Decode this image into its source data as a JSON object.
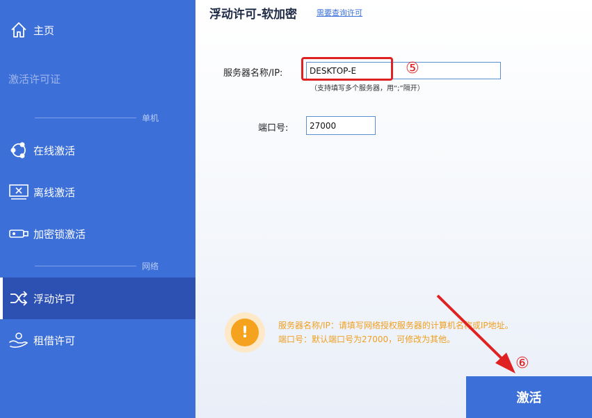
{
  "sidebar": {
    "home_label": "主页",
    "activate_license_label": "激活许可证",
    "section_standalone": "单机",
    "online_label": "在线激活",
    "offline_label": "离线激活",
    "dongle_label": "加密锁激活",
    "section_network": "网络",
    "floating_label": "浮动许可",
    "borrow_label": "租借许可"
  },
  "main": {
    "title": "浮动许可-软加密",
    "query_link": "需要查询许可",
    "server_label": "服务器名称/IP:",
    "server_value": "DESKTOP-E",
    "server_hint": "（支持填写多个服务器，用“;”隔开）",
    "port_label": "端口号:",
    "port_value": "27000",
    "info_line1": "服务器名称/IP：请填写网络授权服务器的计算机名称或IP地址。",
    "info_line2": "端口号：默认端口号为27000，可修改为其他。",
    "activate_button": "激活",
    "step5": "⑤",
    "step6": "⑥"
  },
  "colors": {
    "sidebar": "#3d6fd9",
    "sidebar_active": "#2c51b3",
    "annotation_red": "#e02121",
    "info_orange": "#f5a21e"
  }
}
